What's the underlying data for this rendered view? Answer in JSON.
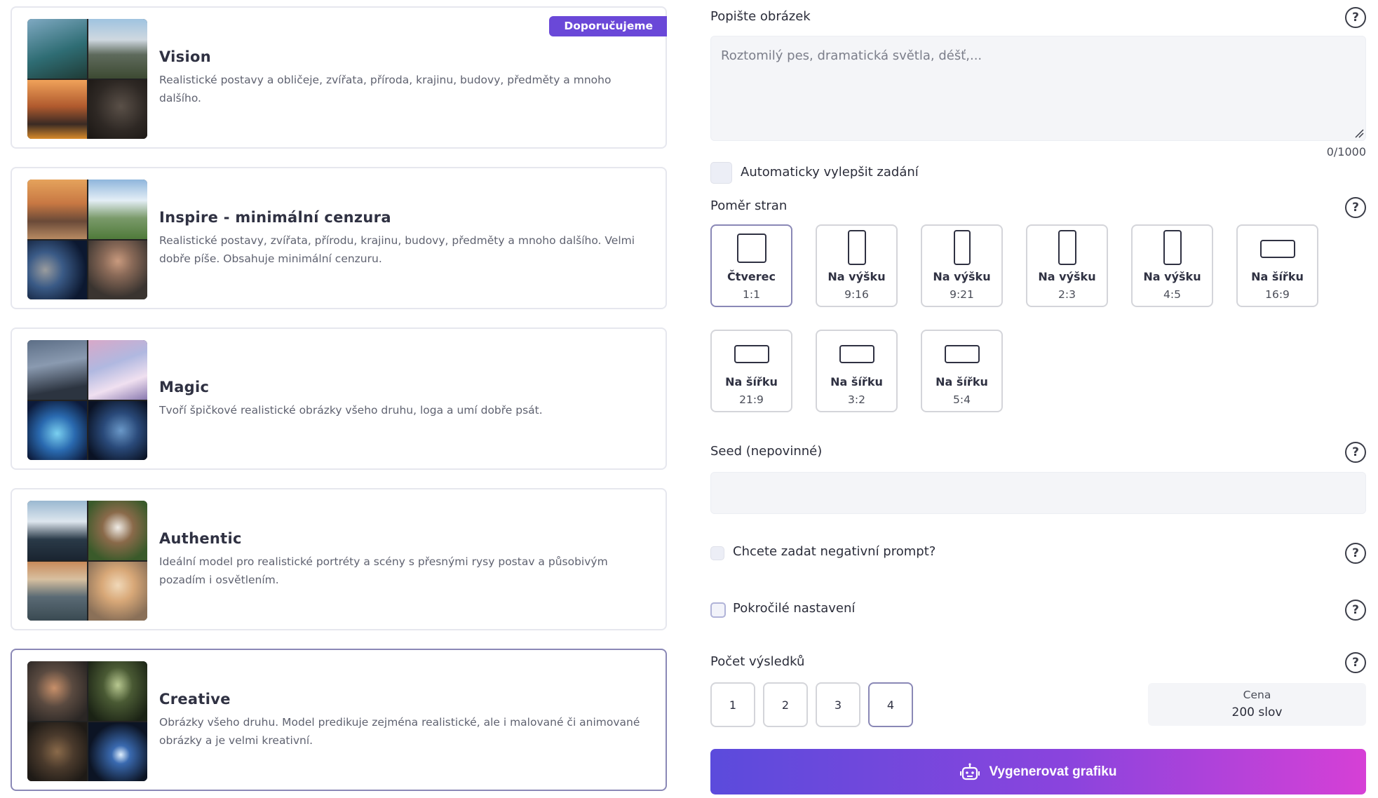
{
  "models": {
    "recommended_badge": "Doporučujeme",
    "items": [
      {
        "title": "Vision",
        "description": "Realistické postavy a obličeje, zvířata, příroda, krajinu, budovy, předměty a mnoho dalšího.",
        "selected": false
      },
      {
        "title": "Inspire - minimální cenzura",
        "description": "Realistické postavy, zvířata, přírodu, krajinu, budovy, předměty a mnoho dalšího. Velmi dobře píše. Obsahuje minimální cenzuru.",
        "selected": false
      },
      {
        "title": "Magic",
        "description": "Tvoří špičkové realistické obrázky všeho druhu, loga a umí dobře psát.",
        "selected": false
      },
      {
        "title": "Authentic",
        "description": "Ideální model pro realistické portréty a scény s přesnými rysy postav a působivým pozadím i osvětlením.",
        "selected": false
      },
      {
        "title": "Creative",
        "description": "Obrázky všeho druhu. Model predikuje zejména realistické, ale i malované či animované obrázky a je velmi kreativní.",
        "selected": true
      }
    ]
  },
  "form": {
    "description": {
      "label": "Popište obrázek",
      "placeholder": "Roztomilý pes, dramatická světla, déšť,...",
      "value": "",
      "counter": "0/1000"
    },
    "auto_improve_label": "Automaticky vylepšit zadání",
    "aspect_ratio": {
      "label": "Poměr stran",
      "options": [
        {
          "name": "Čtverec",
          "ratio": "1:1",
          "selected": true
        },
        {
          "name": "Na výšku",
          "ratio": "9:16",
          "selected": false
        },
        {
          "name": "Na výšku",
          "ratio": "9:21",
          "selected": false
        },
        {
          "name": "Na výšku",
          "ratio": "2:3",
          "selected": false
        },
        {
          "name": "Na výšku",
          "ratio": "4:5",
          "selected": false
        },
        {
          "name": "Na šířku",
          "ratio": "16:9",
          "selected": false
        },
        {
          "name": "Na šířku",
          "ratio": "21:9",
          "selected": false
        },
        {
          "name": "Na šířku",
          "ratio": "3:2",
          "selected": false
        },
        {
          "name": "Na šířku",
          "ratio": "5:4",
          "selected": false
        }
      ]
    },
    "seed": {
      "label": "Seed (nepovinné)",
      "value": ""
    },
    "negative_prompt_label": "Chcete zadat negativní prompt?",
    "advanced_label": "Pokročilé nastavení",
    "results": {
      "label": "Počet výsledků",
      "options": [
        "1",
        "2",
        "3",
        "4"
      ],
      "selected": "4"
    },
    "price": {
      "label": "Cena",
      "value": "200 slov"
    },
    "generate_label": "Vygenerovat grafiku",
    "help_glyph": "?"
  },
  "colors": {
    "accent": "#6a48d8",
    "selected_border": "#8a88b6",
    "button_gradient_start": "#5b4bdc",
    "button_gradient_end": "#d640d6"
  }
}
